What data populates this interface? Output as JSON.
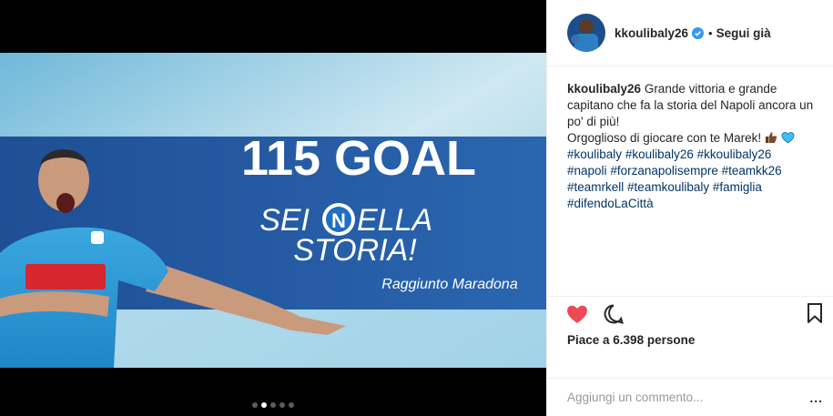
{
  "media": {
    "headline": "115 GOAL",
    "line1_a": "SEI",
    "line1_b": "ELLA",
    "line2": "STORIA!",
    "subline": "Raggiunto Maradona",
    "carousel_count": 5,
    "carousel_active": 2
  },
  "header": {
    "username": "kkoulibaly26",
    "separator": "•",
    "follow_label": "Segui già"
  },
  "caption": {
    "username": "kkoulibaly26",
    "text_line1": "Grande vittoria e grande capitano che fa la storia del Napoli ancora un po' di più!",
    "text_line2": "Orgoglioso di giocare con te Marek!",
    "hashtags": [
      "#koulibaly",
      "#koulibaly26",
      "#kkoulibaly26",
      "#napoli",
      "#forzanapolisempre",
      "#teamkk26",
      "#teamrkell",
      "#teamkoulibaly",
      "#famiglia",
      "#difendoLaCittà"
    ]
  },
  "stats": {
    "likes_text": "Piace a 6.398 persone"
  },
  "comment": {
    "placeholder": "Aggiungi un commento...",
    "more_label": "..."
  },
  "colors": {
    "like_red": "#ed4956",
    "hashtag_blue": "#003569",
    "verified_blue": "#3897f0",
    "banner_blue": "#2760a8"
  }
}
